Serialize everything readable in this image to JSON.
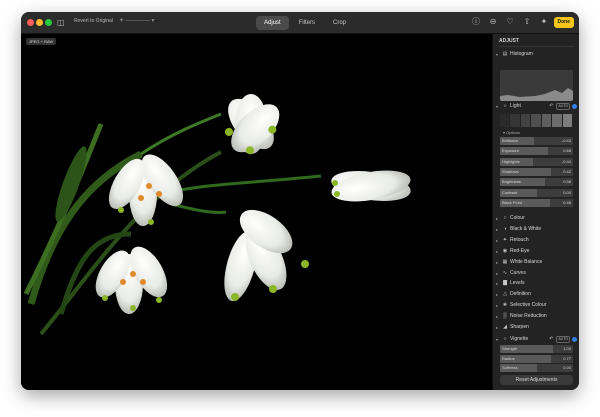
{
  "titlebar": {
    "revert_label": "Revert to Original",
    "magic_label": "✦ ———— ▾",
    "tabs": [
      {
        "label": "Adjust",
        "active": true
      },
      {
        "label": "Filters",
        "active": false
      },
      {
        "label": "Crop",
        "active": false
      }
    ],
    "done_label": "Done",
    "icons": [
      "info-icon",
      "minus-circle-icon",
      "heart-icon",
      "share-icon",
      "magic-wand-icon"
    ]
  },
  "photo": {
    "badge": "JPEG + RAW"
  },
  "panel": {
    "title": "ADJUST",
    "histogram_label": "Histogram",
    "light_label": "Light",
    "light_auto": "AUTO",
    "options_label": "Options",
    "light_sliders": [
      {
        "label": "Brilliance",
        "value": "-0.43",
        "level": 0.47
      },
      {
        "label": "Exposure",
        "value": "0.68",
        "level": 0.66
      },
      {
        "label": "Highlights",
        "value": "-0.44",
        "level": 0.45
      },
      {
        "label": "Shadows",
        "value": "0.42",
        "level": 0.7
      },
      {
        "label": "Brightness",
        "value": "0.56",
        "level": 0.62
      },
      {
        "label": "Contrast",
        "value": "0.00",
        "level": 0.5
      },
      {
        "label": "Black Point",
        "value": "0.46",
        "level": 0.68
      }
    ],
    "sections": [
      {
        "label": "Colour",
        "icon": "circle-icon"
      },
      {
        "label": "Black & White",
        "icon": "half-circle-icon"
      },
      {
        "label": "Retouch",
        "icon": "bandage-icon"
      },
      {
        "label": "Red-Eye",
        "icon": "eye-icon"
      },
      {
        "label": "White Balance",
        "icon": "balance-icon"
      },
      {
        "label": "Curves",
        "icon": "curves-icon"
      },
      {
        "label": "Levels",
        "icon": "levels-icon"
      },
      {
        "label": "Definition",
        "icon": "triangle-icon"
      },
      {
        "label": "Selective Colour",
        "icon": "palette-icon"
      },
      {
        "label": "Noise Reduction",
        "icon": "noise-icon"
      },
      {
        "label": "Sharpen",
        "icon": "sharpen-icon"
      }
    ],
    "vignette_label": "Vignette",
    "vignette_auto": "AUTO",
    "vignette_sliders": [
      {
        "label": "Strength",
        "value": "1.00",
        "level": 0.72
      },
      {
        "label": "Radius",
        "value": "0.77",
        "level": 0.7
      },
      {
        "label": "Softness",
        "value": "0.00",
        "level": 0.5
      }
    ],
    "reset_label": "Reset Adjustments"
  }
}
